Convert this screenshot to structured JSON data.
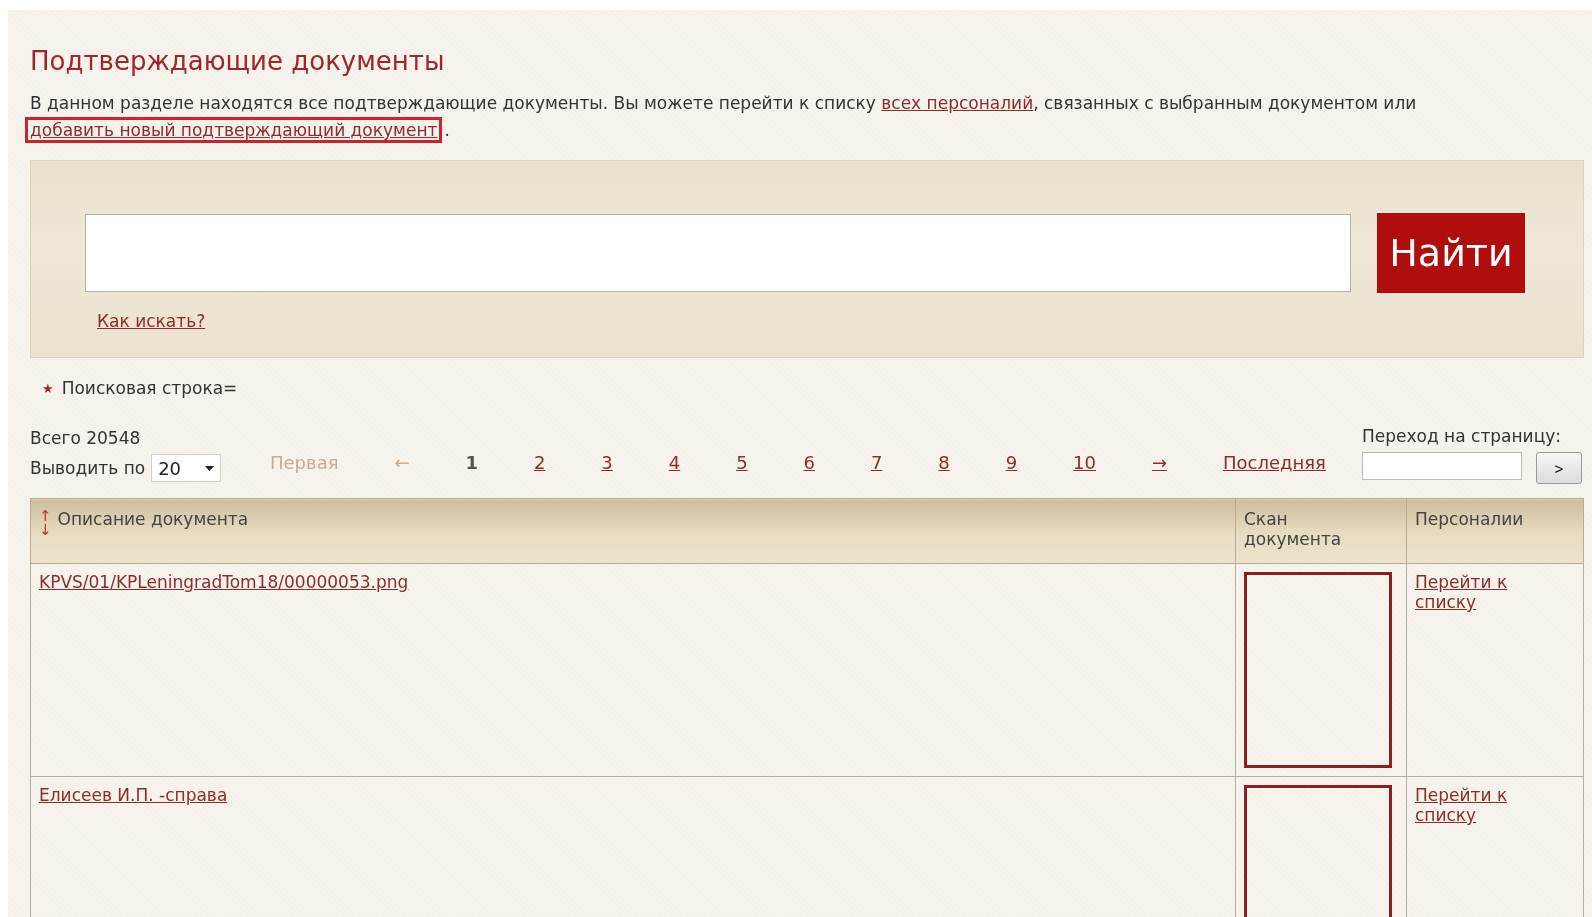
{
  "page": {
    "title": "Подтверждающие документы",
    "intro": [
      {
        "kind": "text",
        "text": "В данном разделе находятся все подтверждающие документы. Вы можете перейти к списку "
      },
      {
        "kind": "link",
        "text": "всех персоналий"
      },
      {
        "kind": "text",
        "text": ", связанных с выбранным документом или "
      },
      {
        "kind": "link",
        "text": "добавить новый подтверждающий документ",
        "highlighted": true
      },
      {
        "kind": "text",
        "text": "."
      }
    ]
  },
  "search": {
    "button": "Найти",
    "help_link": "Как искать?"
  },
  "filters": [
    {
      "marker": "★",
      "text": "Поисковая строка="
    }
  ],
  "summary": {
    "total": "Всего 20548",
    "per_page_label": "Выводить по",
    "per_page_value": "20"
  },
  "pagination": [
    {
      "label": "Первая",
      "disabled": true,
      "selected": false
    },
    {
      "label": "←",
      "disabled": true,
      "selected": false
    },
    {
      "label": "1",
      "disabled": false,
      "selected": true
    },
    {
      "label": "2",
      "disabled": false,
      "selected": false
    },
    {
      "label": "3",
      "disabled": false,
      "selected": false
    },
    {
      "label": "4",
      "disabled": false,
      "selected": false
    },
    {
      "label": "5",
      "disabled": false,
      "selected": false
    },
    {
      "label": "6",
      "disabled": false,
      "selected": false
    },
    {
      "label": "7",
      "disabled": false,
      "selected": false
    },
    {
      "label": "8",
      "disabled": false,
      "selected": false
    },
    {
      "label": "9",
      "disabled": false,
      "selected": false
    },
    {
      "label": "10",
      "disabled": false,
      "selected": false
    },
    {
      "label": "→",
      "disabled": false,
      "selected": false
    },
    {
      "label": "Последняя",
      "disabled": false,
      "selected": false
    }
  ],
  "goto": {
    "label": "Переход на страницу:",
    "button": ">"
  },
  "table": {
    "sort_up": "↑",
    "sort_down": "↓",
    "columns": [
      "Описание документа",
      "Скан документа",
      "Персоналии"
    ],
    "rows": [
      {
        "description": "KPVS/01/KPLeningradTom18/00000053.png",
        "link": "Перейти к списку"
      },
      {
        "description": "Елисеев И.П. -справа",
        "link": "Перейти к списку"
      }
    ]
  }
}
